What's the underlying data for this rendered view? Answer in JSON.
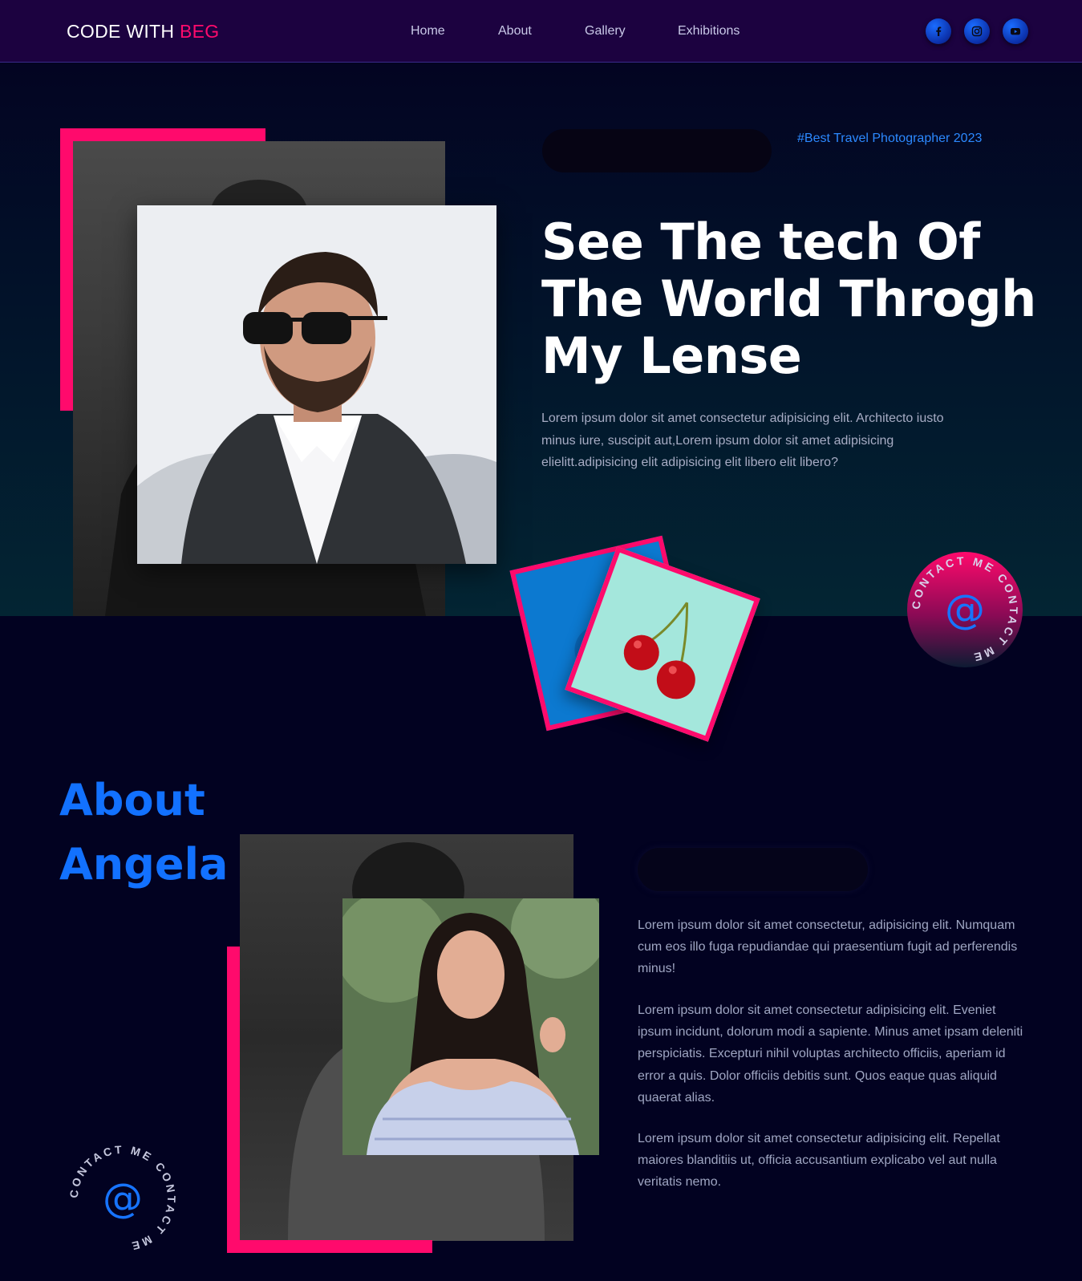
{
  "nav": {
    "logo_main": "CODE WITH ",
    "logo_accent": "BEG",
    "links": [
      "Home",
      "About",
      "Gallery",
      "Exhibitions"
    ],
    "social": [
      "facebook-icon",
      "instagram-icon",
      "youtube-icon"
    ]
  },
  "hero": {
    "tag": "#Best Travel Photographer 2023",
    "title": "See The tech Of The World Throgh My Lense",
    "text": "Lorem ipsum dolor sit amet consectetur adipisicing elit. Architecto iusto minus iure, suscipit aut,Lorem ipsum dolor sit amet adipisicing elielitt.adipisicing elit adipisicing elit libero elit libero?",
    "contact_ring": "CONTACT ME CONTACT ME",
    "contact_symbol": "@"
  },
  "about": {
    "title_line1": "About",
    "title_line2": "Angela Fox",
    "paragraphs": [
      "Lorem ipsum dolor sit amet consectetur, adipisicing elit. Numquam cum eos illo fuga repudiandae qui praesentium fugit ad perferendis minus!",
      "Lorem ipsum dolor sit amet consectetur adipisicing elit. Eveniet ipsum incidunt, dolorum modi a sapiente. Minus amet ipsam deleniti perspiciatis. Excepturi nihil voluptas architecto officiis, aperiam id error a quis. Dolor officiis debitis sunt. Quos eaque quas aliquid quaerat alias.",
      "Lorem ipsum dolor sit amet consectetur adipisicing elit. Repellat maiores blanditiis ut, officia accusantium explicabo vel aut nulla veritatis nemo."
    ],
    "contact_ring": "CONTACT ME CONTACT ME",
    "contact_symbol": "@"
  },
  "colors": {
    "accent_pink": "#ff0a6c",
    "accent_blue": "#1271ff",
    "nav_bg": "#1c0240",
    "page_bg": "#020221"
  }
}
